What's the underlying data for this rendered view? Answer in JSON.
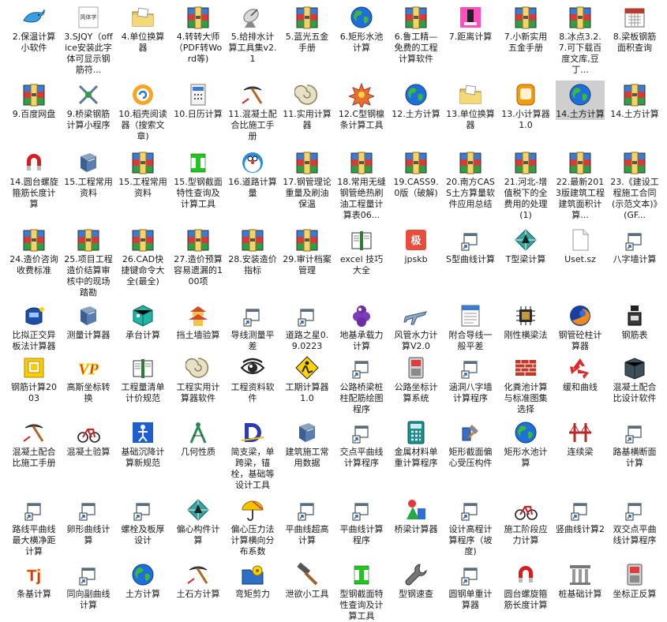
{
  "rows": [
    [
      {
        "label": "2.保温计算小软件",
        "icon": "dolphin-icon"
      },
      {
        "label": "3.SJQY（office安装此字体可显示钢筋符...",
        "icon": "font-file-icon",
        "badge": "简体字"
      },
      {
        "label": "4.单位换算器",
        "icon": "folder-icon"
      },
      {
        "label": "4.转转大师（PDF转Word等)",
        "icon": "winrar-icon"
      },
      {
        "label": "5.给排水计算工具集v2.1",
        "icon": "satellite-dish-icon"
      },
      {
        "label": "5.蓝光五金手册",
        "icon": "winrar-icon"
      },
      {
        "label": "6.矩形水池计算",
        "icon": "globe-icon"
      },
      {
        "label": "6.鲁工精—免费的工程计算软件",
        "icon": "winrar-icon"
      },
      {
        "label": "7.距离计算",
        "icon": "pink-app-icon"
      },
      {
        "label": "7.小新实用五金手册",
        "icon": "winrar-icon"
      },
      {
        "label": "8.冰点3.2.7.可下载百度文库,豆丁...",
        "icon": "winrar-icon"
      },
      {
        "label": "8.梁板钢筋面积查询",
        "icon": "calendar-icon"
      }
    ],
    [
      {
        "label": "9.百度网盘",
        "icon": "winrar-icon"
      },
      {
        "label": "9.桥梁钢筋计算小程序",
        "icon": "crossed-tools-icon"
      },
      {
        "label": "10.稻壳阅读器（搜索文章)",
        "icon": "docer-reader-icon"
      },
      {
        "label": "10.日历计算",
        "icon": "calculator-doc-icon"
      },
      {
        "label": "11.混凝土配合比施工手册",
        "icon": "pickaxe-icon"
      },
      {
        "label": "11.实用计算器",
        "icon": "shell-icon"
      },
      {
        "label": "12.C型钢檩条计算工具",
        "icon": "star-burst-icon"
      },
      {
        "label": "12.土方计算",
        "icon": "globe-icon"
      },
      {
        "label": "13.单位换算器",
        "icon": "folder-icon"
      },
      {
        "label": "13.小计算器1.0",
        "icon": "orange-calc-icon"
      },
      {
        "label": "14.土方计算",
        "icon": "globe-icon",
        "selected": true
      },
      {
        "label": "14.土方计算",
        "icon": "winrar-icon"
      }
    ],
    [
      {
        "label": "14.圆台螺旋箍筋长度计算",
        "icon": "magnet-icon"
      },
      {
        "label": "15.工程常用资料",
        "icon": "book-icon"
      },
      {
        "label": "15.工程常用资料",
        "icon": "winrar-icon"
      },
      {
        "label": "15.型钢截面特性查询及计算工具",
        "icon": "i-beam-icon"
      },
      {
        "label": "16.道路计算量",
        "icon": "doraemon-icon"
      },
      {
        "label": "17.钢管理论重量及刷油保温",
        "icon": "winrar-icon"
      },
      {
        "label": "18.常用无缝钢管绝热刷油工程量计算表06...",
        "icon": "winrar-icon"
      },
      {
        "label": "19.CASS9.0版（破解)",
        "icon": "winrar-icon"
      },
      {
        "label": "20.南方CASS土方算量软件应用总结",
        "icon": "winrar-icon"
      },
      {
        "label": "21.河北-增值税下的全费用的处理(1)",
        "icon": "winrar-icon"
      },
      {
        "label": "22.最新2013版建筑工程建筑面积计算...",
        "icon": "winrar-icon"
      },
      {
        "label": "23.《建设工程施工合同(示范文本)》(GF...",
        "icon": "winrar-icon"
      }
    ],
    [
      {
        "label": "24.造价咨询收费标准",
        "icon": "winrar-icon"
      },
      {
        "label": "25.项目工程造价结算审核中的现场踏勘",
        "icon": "winrar-icon"
      },
      {
        "label": "26.CAD快捷键命令大全(最全)",
        "icon": "winrar-icon"
      },
      {
        "label": "27.造价预算容易遗漏的100项",
        "icon": "winrar-icon"
      },
      {
        "label": "28.安装造价指标",
        "icon": "winrar-icon"
      },
      {
        "label": "29.审计档案管理",
        "icon": "winrar-icon"
      },
      {
        "label": "excel 技巧大全",
        "icon": "open-book-icon"
      },
      {
        "label": "jpskb",
        "icon": "ji-icon",
        "badge": "极"
      },
      {
        "label": "S型曲线计算",
        "icon": "shortcut-icon"
      },
      {
        "label": "T型梁计算",
        "icon": "diamond-icon"
      },
      {
        "label": "Uset.sz",
        "icon": "blank-file-icon"
      },
      {
        "label": "八字墙计算",
        "icon": "shortcut-icon"
      }
    ],
    [
      {
        "label": "比拟正交异板法计算器",
        "icon": "blue-device-icon"
      },
      {
        "label": "测量计算器",
        "icon": "book-icon"
      },
      {
        "label": "承台计算",
        "icon": "cube-icon"
      },
      {
        "label": "挡土墙验算",
        "icon": "pagoda-icon"
      },
      {
        "label": "导线测量平差",
        "icon": "shortcut-icon"
      },
      {
        "label": "道路之星0.9.0223",
        "icon": "shortcut-icon"
      },
      {
        "label": "地基承载力计算",
        "icon": "grape-icon"
      },
      {
        "label": "风管水力计算V2.0",
        "icon": "airplane-icon"
      },
      {
        "label": "附合导线一般平差",
        "icon": "sheet-icon"
      },
      {
        "label": "刚性横梁法",
        "icon": "chip-icon"
      },
      {
        "label": "钢管砼柱计算器",
        "icon": "firefox-icon"
      },
      {
        "label": "钢筋表",
        "icon": "ink-bottle-icon"
      }
    ],
    [
      {
        "label": "钢筋计算2003",
        "icon": "yellow-calc-icon"
      },
      {
        "label": "高斯坐标转换",
        "icon": "vp-icon",
        "badge": "VP"
      },
      {
        "label": "工程量清单计价规范",
        "icon": "open-book-icon"
      },
      {
        "label": "工程实用计算器软件",
        "icon": "shell-icon"
      },
      {
        "label": "工程资料软件",
        "icon": "eye-icon"
      },
      {
        "label": "工期计算器1.0",
        "icon": "worker-sign-icon"
      },
      {
        "label": "公路桥梁桩柱配筋绘图程序",
        "icon": "shortcut-icon"
      },
      {
        "label": "公路坐标计算系统",
        "icon": "red-device-icon"
      },
      {
        "label": "涵洞八字墙计算程序",
        "icon": "shortcut-icon"
      },
      {
        "label": "化粪池计算与标准图集选择",
        "icon": "brick-wall-icon"
      },
      {
        "label": "缓和曲线",
        "icon": "recycle-icon"
      },
      {
        "label": "混凝土配合比设计软件",
        "icon": "dark-block-icon"
      }
    ],
    [
      {
        "label": "混凝土配合比施工手册",
        "icon": "pickaxe-icon"
      },
      {
        "label": "混凝土验算",
        "icon": "bicycle-icon"
      },
      {
        "label": "基础沉降计算新规范",
        "icon": "blue-figure-icon"
      },
      {
        "label": "几何性质",
        "icon": "compass-icon"
      },
      {
        "label": "简支梁，单跨梁，锚栓，基础等设计工具",
        "icon": "d-letter-icon"
      },
      {
        "label": "建筑施工常用数据",
        "icon": "book-icon"
      },
      {
        "label": "交点平曲线计算程序",
        "icon": "shortcut-icon"
      },
      {
        "label": "金属材料单重计算程序",
        "icon": "teal-calc-icon"
      },
      {
        "label": "矩形截面偏心受压构件",
        "icon": "tools-bottle-icon"
      },
      {
        "label": "矩形水池计算",
        "icon": "globe-icon"
      },
      {
        "label": "连续梁",
        "icon": "bridge-icon"
      },
      {
        "label": "路基横断面计算",
        "icon": "shortcut-icon"
      }
    ],
    [
      {
        "label": "路线平曲线最大横净距计算",
        "icon": "shortcut-icon"
      },
      {
        "label": "卵形曲线计算",
        "icon": "shortcut-icon"
      },
      {
        "label": "螺栓及板厚设计",
        "icon": "shortcut-icon"
      },
      {
        "label": "偏心构件计算",
        "icon": "diamond-icon"
      },
      {
        "label": "偏心压力法计算横向分布系数",
        "icon": "umbrella-icon"
      },
      {
        "label": "平曲线超高计算",
        "icon": "shortcut-icon"
      },
      {
        "label": "平曲线计算程序",
        "icon": "shortcut-icon"
      },
      {
        "label": "桥梁计算器",
        "icon": "shapes-icon"
      },
      {
        "label": "设计高程计算程序（坡度)",
        "icon": "shortcut-icon"
      },
      {
        "label": "施工阶段应力计算",
        "icon": "bicycle-icon"
      },
      {
        "label": "竖曲线计算2",
        "icon": "shortcut-icon"
      },
      {
        "label": "双交点平曲线计算程序",
        "icon": "shortcut-icon"
      }
    ],
    [
      {
        "label": "条基计算",
        "icon": "tj-icon",
        "badge": "Tj"
      },
      {
        "label": "同向副曲线计算",
        "icon": "shortcut-icon"
      },
      {
        "label": "土方计算",
        "icon": "globe-icon"
      },
      {
        "label": "土石方计算",
        "icon": "pickaxe-icon"
      },
      {
        "label": "弯矩剪力",
        "icon": "gear-folder-icon"
      },
      {
        "label": "泄欲小工具",
        "icon": "hammer-icon"
      },
      {
        "label": "型钢截面特性查询及计算工具",
        "icon": "i-beam-icon"
      },
      {
        "label": "型钢速查",
        "icon": "wrench-icon"
      },
      {
        "label": "圆钢单重计算器",
        "icon": "shortcut-icon"
      },
      {
        "label": "圆台螺旋箍筋长度计算",
        "icon": "magnet-icon"
      },
      {
        "label": "桩基础计算",
        "icon": "pillars-icon"
      },
      {
        "label": "坐标正反算",
        "icon": "red-device-icon"
      }
    ]
  ]
}
